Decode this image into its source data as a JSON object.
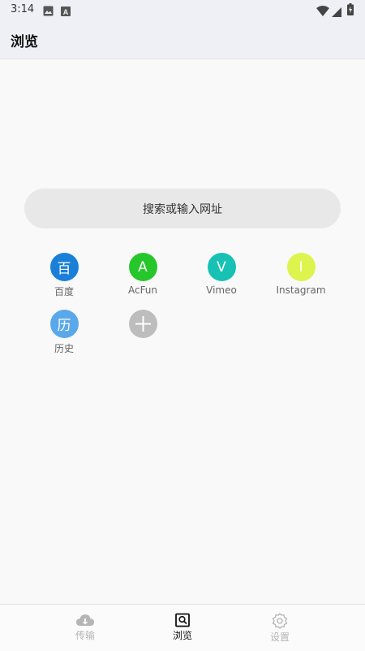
{
  "status_bar": {
    "time": "3:14",
    "icons": [
      "image-icon",
      "text-a-icon",
      "wifi-icon",
      "signal-icon",
      "battery-icon"
    ]
  },
  "header": {
    "title": "浏览"
  },
  "search": {
    "placeholder": "搜索或输入网址"
  },
  "shortcuts": [
    {
      "label": "百度",
      "glyph": "百",
      "color": "#1a7fd9"
    },
    {
      "label": "AcFun",
      "glyph": "A",
      "color": "#27c72b"
    },
    {
      "label": "Vimeo",
      "glyph": "V",
      "color": "#17c1b4"
    },
    {
      "label": "Instagram",
      "glyph": "I",
      "color": "#dcf44d"
    },
    {
      "label": "历史",
      "glyph": "历",
      "color": "#5aa8ea"
    },
    {
      "label": "",
      "glyph": "",
      "icon": "plus-icon",
      "color": "#bdbdbd"
    }
  ],
  "bottom_nav": {
    "items": [
      {
        "label": "传输",
        "icon": "cloud-download-icon",
        "active": false
      },
      {
        "label": "浏览",
        "icon": "browse-search-icon",
        "active": true
      },
      {
        "label": "设置",
        "icon": "gear-icon",
        "active": false
      }
    ],
    "colors": {
      "active": "#111111",
      "inactive": "#b5b5b5"
    }
  }
}
